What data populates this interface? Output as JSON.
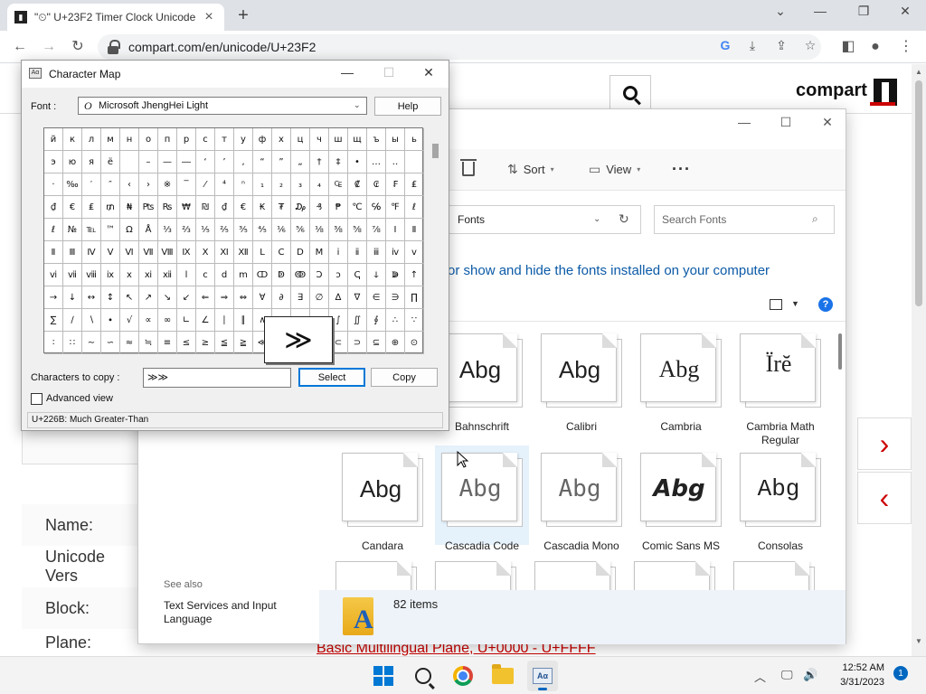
{
  "browser": {
    "tab_title": "\"⏲\" U+23F2 Timer Clock Unicode",
    "tab_favicon": "compart-logo-icon",
    "url": "compart.com/en/unicode/U+23F2",
    "window_controls": [
      "chevron-down-icon",
      "minimize-icon",
      "restore-icon",
      "close-icon"
    ],
    "toolbar_icons": [
      "back-icon",
      "forward-icon",
      "reload-icon",
      "lock-icon",
      "google-icon",
      "download-icon",
      "share-icon",
      "star-icon",
      "sidebar-icon",
      "profile-icon",
      "menu-icon"
    ]
  },
  "site": {
    "logo_text": "compart",
    "rows": [
      {
        "label": "Name:"
      },
      {
        "label": "Unicode Vers"
      },
      {
        "label": "Block:"
      },
      {
        "label": "Plane:"
      }
    ],
    "plane_value": "Basic Multilingual Plane, U+0000 - U+FFFF",
    "next_arrow": "›",
    "prev_arrow": "‹",
    "accent": "#cc0000"
  },
  "fonts_window": {
    "commands": {
      "sort": "Sort",
      "view": "View",
      "more": "···"
    },
    "address": "Fonts",
    "search_placeholder": "Search Fonts",
    "description": "or show and hide the fonts installed on your computer",
    "help": "?",
    "tiles": [
      {
        "sample": "Abg",
        "label": "Bahnschrift"
      },
      {
        "sample": "Abg",
        "label": "Calibri"
      },
      {
        "sample": "Abg",
        "label": "Cambria"
      },
      {
        "sample": "Ïrĕ",
        "label": "Cambria Math Regular"
      },
      {
        "sample": "Abg",
        "label": "Candara"
      },
      {
        "sample": "Abg",
        "label": "Cascadia Code"
      },
      {
        "sample": "Abg",
        "label": "Cascadia Mono"
      },
      {
        "sample": "Abg",
        "label": "Comic Sans MS"
      },
      {
        "sample": "Abg",
        "label": "Consolas"
      }
    ],
    "see_also": "See also",
    "see_also_link": "Text Services and Input Language",
    "items_count": "82 items",
    "folder_letter": "A"
  },
  "charmap": {
    "title": "Character Map",
    "font_label": "Font :",
    "font_icon": "O",
    "font_name": "Microsoft JhengHei Light",
    "help_button": "Help",
    "grid_rows": [
      [
        "й",
        "к",
        "л",
        "м",
        "н",
        "о",
        "п",
        "р",
        "с",
        "т",
        "у",
        "ф",
        "х",
        "ц",
        "ч",
        "ш",
        "щ",
        "ъ",
        "ы",
        "ь"
      ],
      [
        "э",
        "ю",
        "я",
        "ё",
        "",
        "–",
        "—",
        "―",
        "‘",
        "’",
        "‚",
        "“",
        "”",
        "„",
        "†",
        "‡",
        "•",
        "…",
        "‥",
        ""
      ],
      [
        "·",
        "‰",
        "′",
        "″",
        "‹",
        "›",
        "※",
        "‾",
        "⁄",
        "⁴",
        "ⁿ",
        "₁",
        "₂",
        "₃",
        "₄",
        "₠",
        "₡",
        "₢",
        "₣",
        "₤"
      ],
      [
        "₫",
        "€",
        "₤",
        "₥",
        "₦",
        "₧",
        "₨",
        "₩",
        "₪",
        "₫",
        "€",
        "₭",
        "₮",
        "₯",
        "₰",
        "₱",
        "℃",
        "℅",
        "℉",
        "ℓ"
      ],
      [
        "ℓ",
        "№",
        "℡",
        "™",
        "Ω",
        "Å",
        "⅓",
        "⅔",
        "⅕",
        "⅖",
        "⅗",
        "⅘",
        "⅙",
        "⅚",
        "⅛",
        "⅜",
        "⅝",
        "⅞",
        "Ⅰ",
        "Ⅱ"
      ],
      [
        "Ⅱ",
        "Ⅲ",
        "Ⅳ",
        "Ⅴ",
        "Ⅵ",
        "Ⅶ",
        "Ⅷ",
        "Ⅸ",
        "Ⅹ",
        "Ⅺ",
        "Ⅻ",
        "Ⅼ",
        "Ⅽ",
        "Ⅾ",
        "Ⅿ",
        "ⅰ",
        "ⅱ",
        "ⅲ",
        "ⅳ",
        "ⅴ"
      ],
      [
        "ⅵ",
        "ⅶ",
        "ⅷ",
        "ⅸ",
        "ⅹ",
        "ⅺ",
        "ⅻ",
        "ⅼ",
        "ⅽ",
        "ⅾ",
        "ⅿ",
        "ↀ",
        "ↁ",
        "ↂ",
        "Ↄ",
        "ↄ",
        "ↅ",
        "ↆ",
        "ↇ",
        "↑"
      ],
      [
        "→",
        "↓",
        "↔",
        "↕",
        "↖",
        "↗",
        "↘",
        "↙",
        "⇐",
        "⇒",
        "⇔",
        "∀",
        "∂",
        "∃",
        "∅",
        "∆",
        "∇",
        "∈",
        "∋",
        "∏"
      ],
      [
        "∑",
        "∕",
        "∖",
        "∙",
        "√",
        "∝",
        "∞",
        "∟",
        "∠",
        "∣",
        "∥",
        "∧",
        "∨",
        "∩",
        "∪",
        "∫",
        "∬",
        "∮",
        "∴",
        "∵"
      ],
      [
        "∶",
        "∷",
        "∼",
        "∽",
        "≈",
        "≒",
        "≡",
        "≤",
        "≥",
        "≦",
        "≧",
        "≪",
        "≫",
        "≮",
        "≯",
        "⊂",
        "⊃",
        "⊆",
        "⊕",
        "⊙"
      ]
    ],
    "magnified_char": "≫",
    "copy_label": "Characters to copy :",
    "copy_value": "≫≫",
    "select_button": "Select",
    "copy_button": "Copy",
    "advanced_view": "Advanced view",
    "status": "U+226B: Much Greater-Than"
  },
  "taskbar": {
    "apps": [
      "start-icon",
      "search-icon",
      "chrome-icon",
      "file-explorer-icon",
      "character-map-icon"
    ],
    "time": "12:52 AM",
    "date": "3/31/2023",
    "notifications": "1"
  }
}
